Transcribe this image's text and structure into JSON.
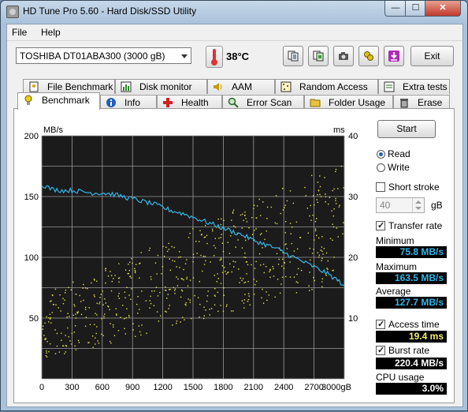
{
  "window": {
    "title": "HD Tune Pro 5.60 - Hard Disk/SSD Utility"
  },
  "menu": [
    "File",
    "Help"
  ],
  "toolbar": {
    "drive": "TOSHIBA DT01ABA300 (3000 gB)",
    "temperature": "38°C",
    "exit_label": "Exit",
    "icons": [
      "copy-info-icon",
      "copy-screenshot-icon",
      "camera-icon",
      "tools-icon",
      "download-icon"
    ]
  },
  "tabs_row1": [
    "File Benchmark",
    "Disk monitor",
    "AAM",
    "Random Access",
    "Extra tests"
  ],
  "tabs_row2": [
    "Benchmark",
    "Info",
    "Health",
    "Error Scan",
    "Folder Usage",
    "Erase"
  ],
  "active_tab": "Benchmark",
  "controls": {
    "start_label": "Start",
    "read_label": "Read",
    "write_label": "Write",
    "mode": "Read",
    "short_stroke_label": "Short stroke",
    "short_stroke_checked": false,
    "short_stroke_value": "40",
    "short_stroke_unit": "gB",
    "transfer_rate_label": "Transfer rate",
    "transfer_rate_checked": true,
    "access_time_label": "Access time",
    "access_time_checked": true,
    "burst_rate_label": "Burst rate",
    "burst_rate_checked": true
  },
  "results": {
    "minimum_label": "Minimum",
    "minimum": "75.8 MB/s",
    "maximum_label": "Maximum",
    "maximum": "163.5 MB/s",
    "average_label": "Average",
    "average": "127.7 MB/s",
    "access_time": "19.4 ms",
    "burst_rate": "220.4 MB/s",
    "cpu_usage_label": "CPU usage",
    "cpu_usage": "3.0%"
  },
  "colors": {
    "transfer_line": "#34b6e6",
    "access_points": "#e6e24a",
    "plot_bg": "#1b1b1b",
    "grid": "#9a9a9a"
  },
  "chart_data": {
    "type": "line",
    "xlabel": "gB",
    "ylabel_left": "MB/s",
    "ylabel_right": "ms",
    "xlim": [
      0,
      3000
    ],
    "ylim_left": [
      0,
      200
    ],
    "ylim_right": [
      0,
      40
    ],
    "x_ticks": [
      "0",
      "300",
      "600",
      "900",
      "1200",
      "1500",
      "1800",
      "2100",
      "2400",
      "2700",
      "3000gB"
    ],
    "y_ticks_left": [
      "50",
      "100",
      "150",
      "200"
    ],
    "y_ticks_right": [
      "10",
      "20",
      "30",
      "40"
    ],
    "grid": true,
    "series": [
      {
        "name": "Transfer rate",
        "axis": "left",
        "x": [
          0,
          100,
          200,
          300,
          400,
          500,
          600,
          700,
          800,
          900,
          1000,
          1100,
          1200,
          1300,
          1400,
          1500,
          1600,
          1700,
          1800,
          1900,
          2000,
          2100,
          2200,
          2300,
          2400,
          2500,
          2600,
          2700,
          2800,
          2900,
          3000
        ],
        "y": [
          160,
          156,
          155,
          155,
          154,
          153,
          153,
          152,
          150,
          148,
          146,
          144,
          141,
          138,
          136,
          133,
          130,
          127,
          124,
          121,
          118,
          114,
          111,
          108,
          104,
          100,
          96,
          92,
          88,
          83,
          77
        ]
      },
      {
        "name": "Access time",
        "axis": "right",
        "type": "scatter",
        "x_range": [
          0,
          3000
        ],
        "y_band_low_start": 3,
        "y_band_low_end": 16,
        "y_band_high_start": 14,
        "y_band_high_end": 36
      }
    ]
  }
}
